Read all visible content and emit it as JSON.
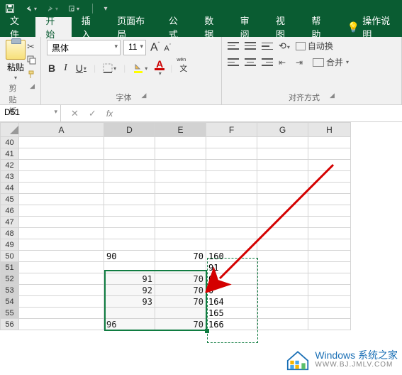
{
  "titlebar": {
    "save_tip": "保存",
    "undo_tip": "撤销",
    "redo_tip": "重做",
    "preview_tip": "预览"
  },
  "menu": {
    "file": "文件",
    "home": "开始",
    "insert": "插入",
    "layout": "页面布局",
    "formulas": "公式",
    "data": "数据",
    "review": "审阅",
    "view": "视图",
    "help": "帮助",
    "tell_me": "操作说明"
  },
  "ribbon": {
    "clipboard": {
      "paste": "粘贴",
      "label": "剪贴板"
    },
    "font": {
      "name": "黑体",
      "size": "11",
      "bold": "B",
      "italic": "I",
      "underline": "U",
      "color_letter": "A",
      "pinyin": "文",
      "label": "字体"
    },
    "align": {
      "wrap": "自动换",
      "merge": "合并",
      "label": "对齐方式"
    }
  },
  "namebox": {
    "ref": "D51"
  },
  "columns": [
    "A",
    "D",
    "E",
    "F",
    "G",
    "H"
  ],
  "rows": [
    40,
    41,
    42,
    43,
    44,
    45,
    46,
    47,
    48,
    49,
    50,
    51,
    52,
    53,
    54,
    55,
    56
  ],
  "cells": {
    "D50": "90",
    "E50": "70",
    "F50": "160",
    "F51": "91",
    "D52": "91",
    "E52": "70",
    "F52": "0",
    "D53": "92",
    "E53": "70",
    "F53": "0",
    "D54": "93",
    "E54": "70",
    "F54": "164",
    "F55": "165",
    "D56": "96",
    "E56": "70",
    "F56": "166"
  },
  "watermark": {
    "main": "Windows 系统之家",
    "sub": "WWW.BJ.JMLV.COM"
  },
  "chart_data": null
}
